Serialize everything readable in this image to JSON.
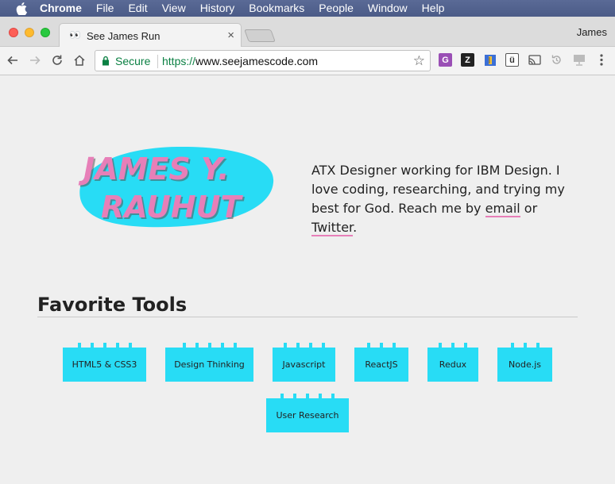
{
  "menubar": {
    "app": "Chrome",
    "items": [
      "File",
      "Edit",
      "View",
      "History",
      "Bookmarks",
      "People",
      "Window",
      "Help"
    ]
  },
  "tab": {
    "favicon": "👀",
    "title": "See James Run"
  },
  "profile_name": "James",
  "omnibox": {
    "secure_label": "Secure",
    "scheme": "https://",
    "host": "www.seejamescode.com"
  },
  "extensions": [
    {
      "icon": "grammarly-icon",
      "label": "G",
      "bg": "#9a4fb5",
      "fg": "#ffffff"
    },
    {
      "icon": "zotero-icon",
      "label": "Z",
      "bg": "#222222",
      "fg": "#ffffff"
    },
    {
      "icon": "ruler-icon",
      "label": "",
      "bg": "#3b6fd6",
      "fg": "#ffffff"
    },
    {
      "icon": "ublock-icon",
      "label": "ü",
      "bg": "#ffffff",
      "fg": "#333333"
    },
    {
      "icon": "cast-icon",
      "label": "",
      "bg": "transparent",
      "fg": "#555555"
    },
    {
      "icon": "history-icon",
      "label": "",
      "bg": "transparent",
      "fg": "#999999"
    },
    {
      "icon": "screen-icon",
      "label": "",
      "bg": "transparent",
      "fg": "#999999"
    },
    {
      "icon": "menu-icon",
      "label": "",
      "bg": "transparent",
      "fg": "#555555"
    }
  ],
  "logo": {
    "line1": "JAMES Y.",
    "line2": "RAUHUT",
    "blob_color": "#28dcf5",
    "text_color": "#e77fb8"
  },
  "bio": {
    "text_before": "ATX Designer working for IBM Design. I love coding, researching, and trying my best for God. Reach me by ",
    "email_label": "email",
    "middle": " or ",
    "twitter_label": "Twitter",
    "end": "."
  },
  "tools": {
    "title": "Favorite Tools",
    "items": [
      "HTML5 & CSS3",
      "Design Thinking",
      "Javascript",
      "ReactJS",
      "Redux",
      "Node.js",
      "User Research"
    ]
  }
}
